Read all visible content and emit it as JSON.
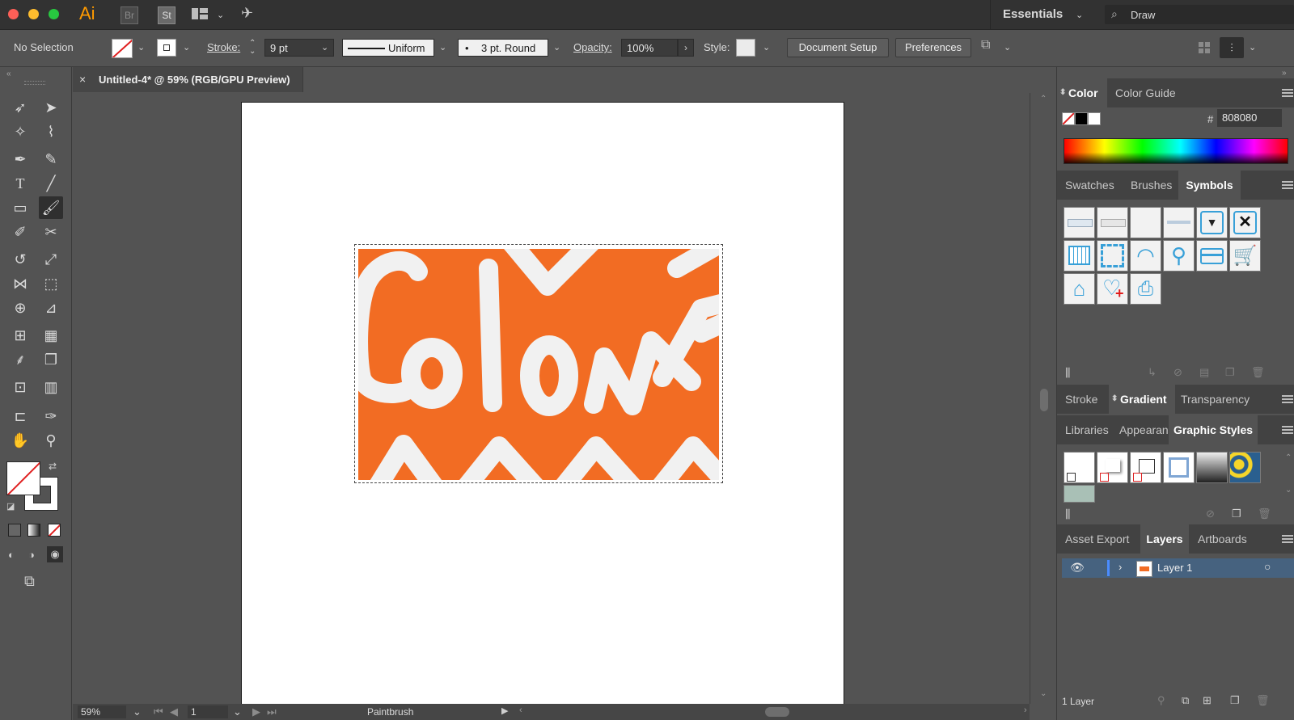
{
  "appbar": {
    "app_name": "Ai",
    "bridge_label": "Br",
    "stock_label": "St",
    "workspace": "Essentials",
    "search_value": "Draw"
  },
  "control": {
    "selection_label": "No Selection",
    "stroke_label": "Stroke:",
    "stroke_value": "9 pt",
    "profile_value": "Uniform",
    "brush_value": "3 pt. Round",
    "opacity_label": "Opacity:",
    "opacity_value": "100%",
    "style_label": "Style:",
    "document_setup": "Document Setup",
    "preferences": "Preferences"
  },
  "document": {
    "tab_title": "Untitled-4* @ 59% (RGB/GPU Preview)",
    "artwork_color": "#F26C23"
  },
  "color_panel": {
    "tabs": [
      "Color",
      "Color Guide"
    ],
    "hex_label": "#",
    "hex_value": "808080"
  },
  "symbols_panel": {
    "tabs": [
      "Swatches",
      "Brushes",
      "Symbols"
    ]
  },
  "gradient_panel": {
    "tabs": [
      "Stroke",
      "Gradient",
      "Transparency"
    ]
  },
  "styles_panel": {
    "tabs": [
      "Libraries",
      "Appearan",
      "Graphic Styles"
    ]
  },
  "layers_panel": {
    "tabs": [
      "Asset Export",
      "Layers",
      "Artboards"
    ],
    "layer_name": "Layer 1",
    "layer_count": "1 Layer"
  },
  "status": {
    "zoom": "59%",
    "artboard_number": "1",
    "current_tool": "Paintbrush"
  }
}
